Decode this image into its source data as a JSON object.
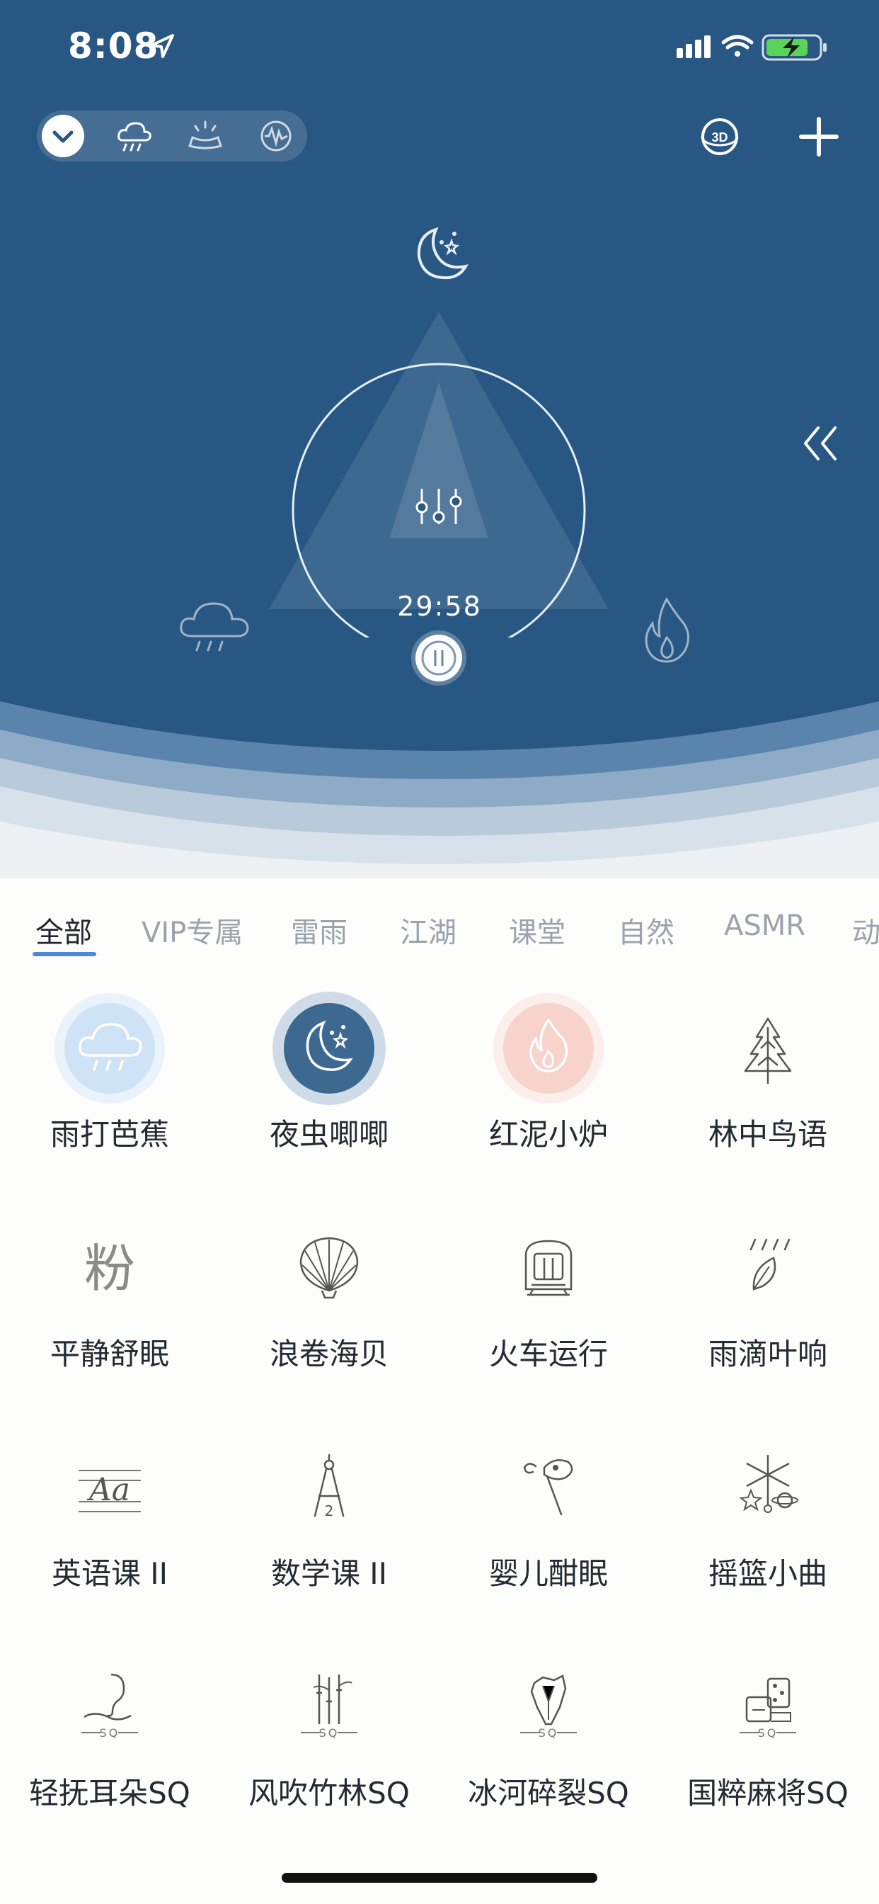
{
  "status_bar": {
    "time": "8:08"
  },
  "player": {
    "timer": "29:58"
  },
  "top_bar": {
    "badge_3d": "3D"
  },
  "tabs": [
    {
      "label": "全部",
      "active": true
    },
    {
      "label": "VIP专属"
    },
    {
      "label": "雷雨"
    },
    {
      "label": "江湖"
    },
    {
      "label": "课堂"
    },
    {
      "label": "自然"
    },
    {
      "label": "ASMR"
    },
    {
      "label": "动"
    }
  ],
  "sounds": [
    {
      "label": "雨打芭蕉",
      "icon": "rain-cloud-icon",
      "selected": true,
      "color": "#cfe3f6"
    },
    {
      "label": "夜虫唧唧",
      "icon": "moon-stars-icon",
      "selected": true,
      "color": "#3d6991"
    },
    {
      "label": "红泥小炉",
      "icon": "flame-icon",
      "selected": true,
      "color": "#f7d3cc"
    },
    {
      "label": "林中鸟语",
      "icon": "pine-tree-icon"
    },
    {
      "label": "平静舒眠",
      "icon": "fen-character-icon",
      "icon_text": "粉"
    },
    {
      "label": "浪卷海贝",
      "icon": "seashell-icon"
    },
    {
      "label": "火车运行",
      "icon": "train-icon"
    },
    {
      "label": "雨滴叶响",
      "icon": "rain-leaf-icon"
    },
    {
      "label": "英语课 II",
      "icon": "english-aa-icon",
      "icon_text": "Aa"
    },
    {
      "label": "数学课 II",
      "icon": "compass-icon",
      "icon_text": "2"
    },
    {
      "label": "婴儿酣眠",
      "icon": "rattle-icon"
    },
    {
      "label": "摇篮小曲",
      "icon": "mobile-toy-icon"
    },
    {
      "label": "轻抚耳朵SQ",
      "icon": "ear-hand-icon",
      "icon_text": "SQ"
    },
    {
      "label": "风吹竹林SQ",
      "icon": "bamboo-icon",
      "icon_text": "SQ"
    },
    {
      "label": "冰河碎裂SQ",
      "icon": "ice-icon",
      "icon_text": "SQ"
    },
    {
      "label": "国粹麻将SQ",
      "icon": "mahjong-icon",
      "icon_text": "SQ"
    }
  ],
  "colors": {
    "hero_bg": "#285784",
    "accent": "#4a8bd8"
  }
}
